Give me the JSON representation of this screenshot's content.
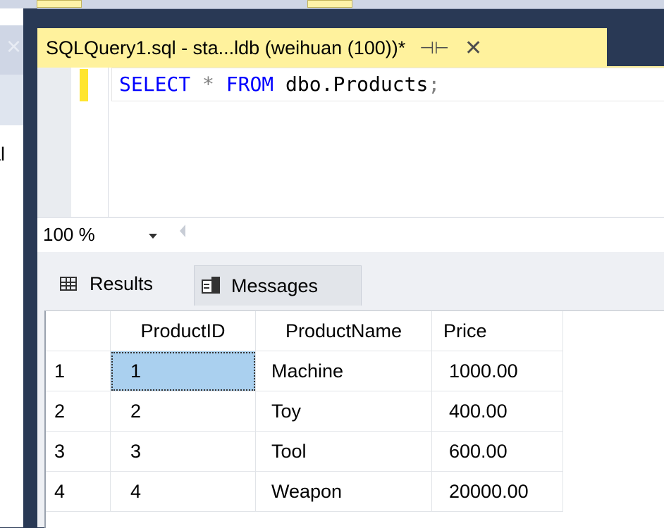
{
  "query_tab": {
    "title": "SQLQuery1.sql - sta...ldb (weihuan (100))*",
    "pin_icon": "pin-icon",
    "close_icon": "close-icon"
  },
  "left_panel": {
    "partial_text": "al"
  },
  "editor": {
    "code": {
      "keyword_select": "SELECT",
      "star": "*",
      "keyword_from": "FROM",
      "table": "dbo.Products",
      "terminator": ";"
    }
  },
  "zoom": {
    "value": "100 %"
  },
  "results_tabs": [
    {
      "label": "Results",
      "icon": "grid-icon"
    },
    {
      "label": "Messages",
      "icon": "messages-icon"
    }
  ],
  "grid": {
    "columns": [
      "ProductID",
      "ProductName",
      "Price"
    ],
    "rows": [
      {
        "row_num": "1",
        "ProductID": "1",
        "ProductName": "Machine",
        "Price": "1000.00"
      },
      {
        "row_num": "2",
        "ProductID": "2",
        "ProductName": "Toy",
        "Price": "400.00"
      },
      {
        "row_num": "3",
        "ProductID": "3",
        "ProductName": "Tool",
        "Price": "600.00"
      },
      {
        "row_num": "4",
        "ProductID": "4",
        "ProductName": "Weapon",
        "Price": "20000.00"
      }
    ]
  },
  "colors": {
    "tab_active": "#fff29d",
    "selection": "#aad0ef",
    "keyword": "#0000ff",
    "frame": "#293955"
  }
}
